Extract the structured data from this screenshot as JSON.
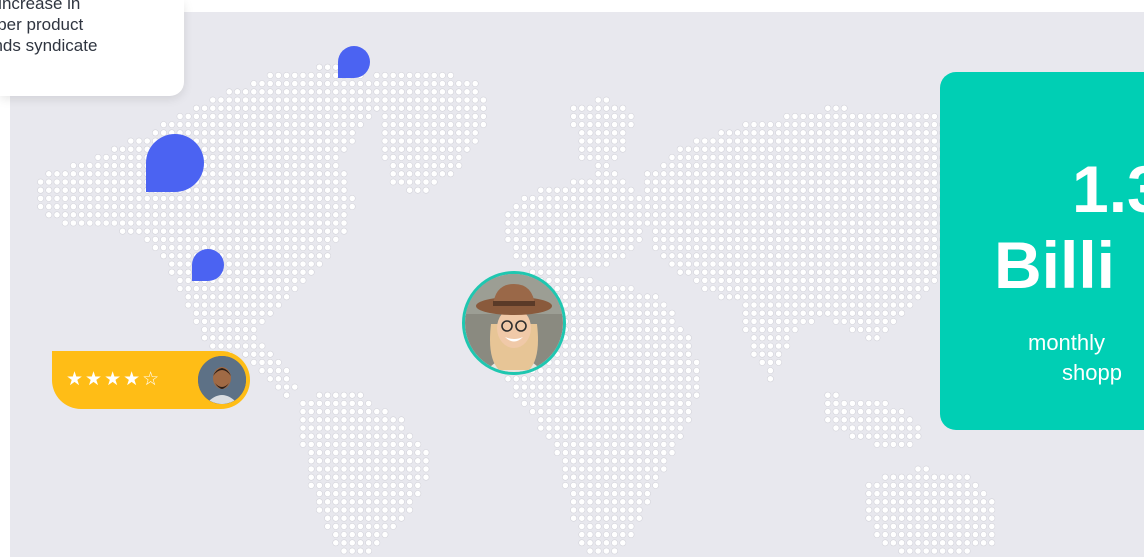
{
  "callout": {
    "lines": [
      "n increase in",
      "s per product",
      "ands syndicate"
    ]
  },
  "rating": {
    "stars": "★★★★",
    "empty_star": "☆",
    "filled_count": 4,
    "total": 5
  },
  "stat": {
    "value": "1.3",
    "unit": "Billi",
    "desc_line1": "monthly",
    "desc_line2": "shopp"
  },
  "colors": {
    "map_background": "#e8e8ee",
    "dots": "#ffffff",
    "pin": "#4b63f2",
    "rating_pill": "#ffbd16",
    "stat_card": "#00cfb4",
    "avatar_ring": "#1fc7b0"
  },
  "icons": {
    "pins": [
      "location-pin-icon",
      "location-pin-icon",
      "location-pin-icon"
    ],
    "avatars": [
      "shopper-avatar",
      "reviewer-avatar"
    ]
  }
}
